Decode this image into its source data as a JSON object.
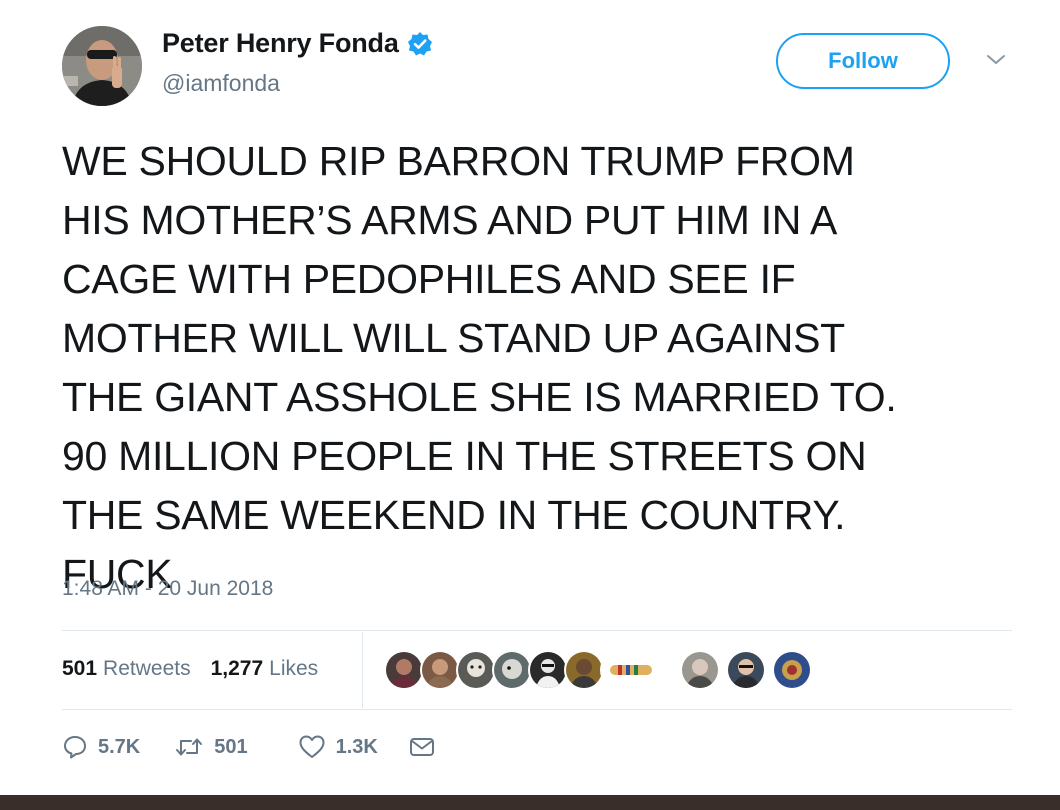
{
  "user": {
    "display_name": "Peter Henry Fonda",
    "handle": "@iamfonda",
    "verified": true
  },
  "header": {
    "follow_label": "Follow"
  },
  "tweet": {
    "lines": [
      "WE SHOULD RIP BARRON TRUMP FROM",
      "HIS MOTHER’S ARMS AND PUT HIM IN A",
      "CAGE WITH PEDOPHILES AND SEE IF",
      "MOTHER WILL WILL STAND UP AGAINST",
      "THE GIANT ASSHOLE SHE IS MARRIED TO.",
      "90 MILLION PEOPLE IN THE STREETS ON",
      "THE SAME WEEKEND IN THE COUNTRY.",
      "FUCK"
    ],
    "timestamp": "1:48 AM - 20 Jun 2018"
  },
  "stats": {
    "retweets_count": "501",
    "retweets_label": "Retweets",
    "likes_count": "1,277",
    "likes_label": "Likes"
  },
  "actions": {
    "reply_count": "5.7K",
    "retweet_count": "501",
    "like_count": "1.3K"
  },
  "colors": {
    "accent": "#1da1f2",
    "secondary_text": "#657786",
    "divider": "#e1e8ed",
    "bottom_strip": "#3a2e2b"
  }
}
